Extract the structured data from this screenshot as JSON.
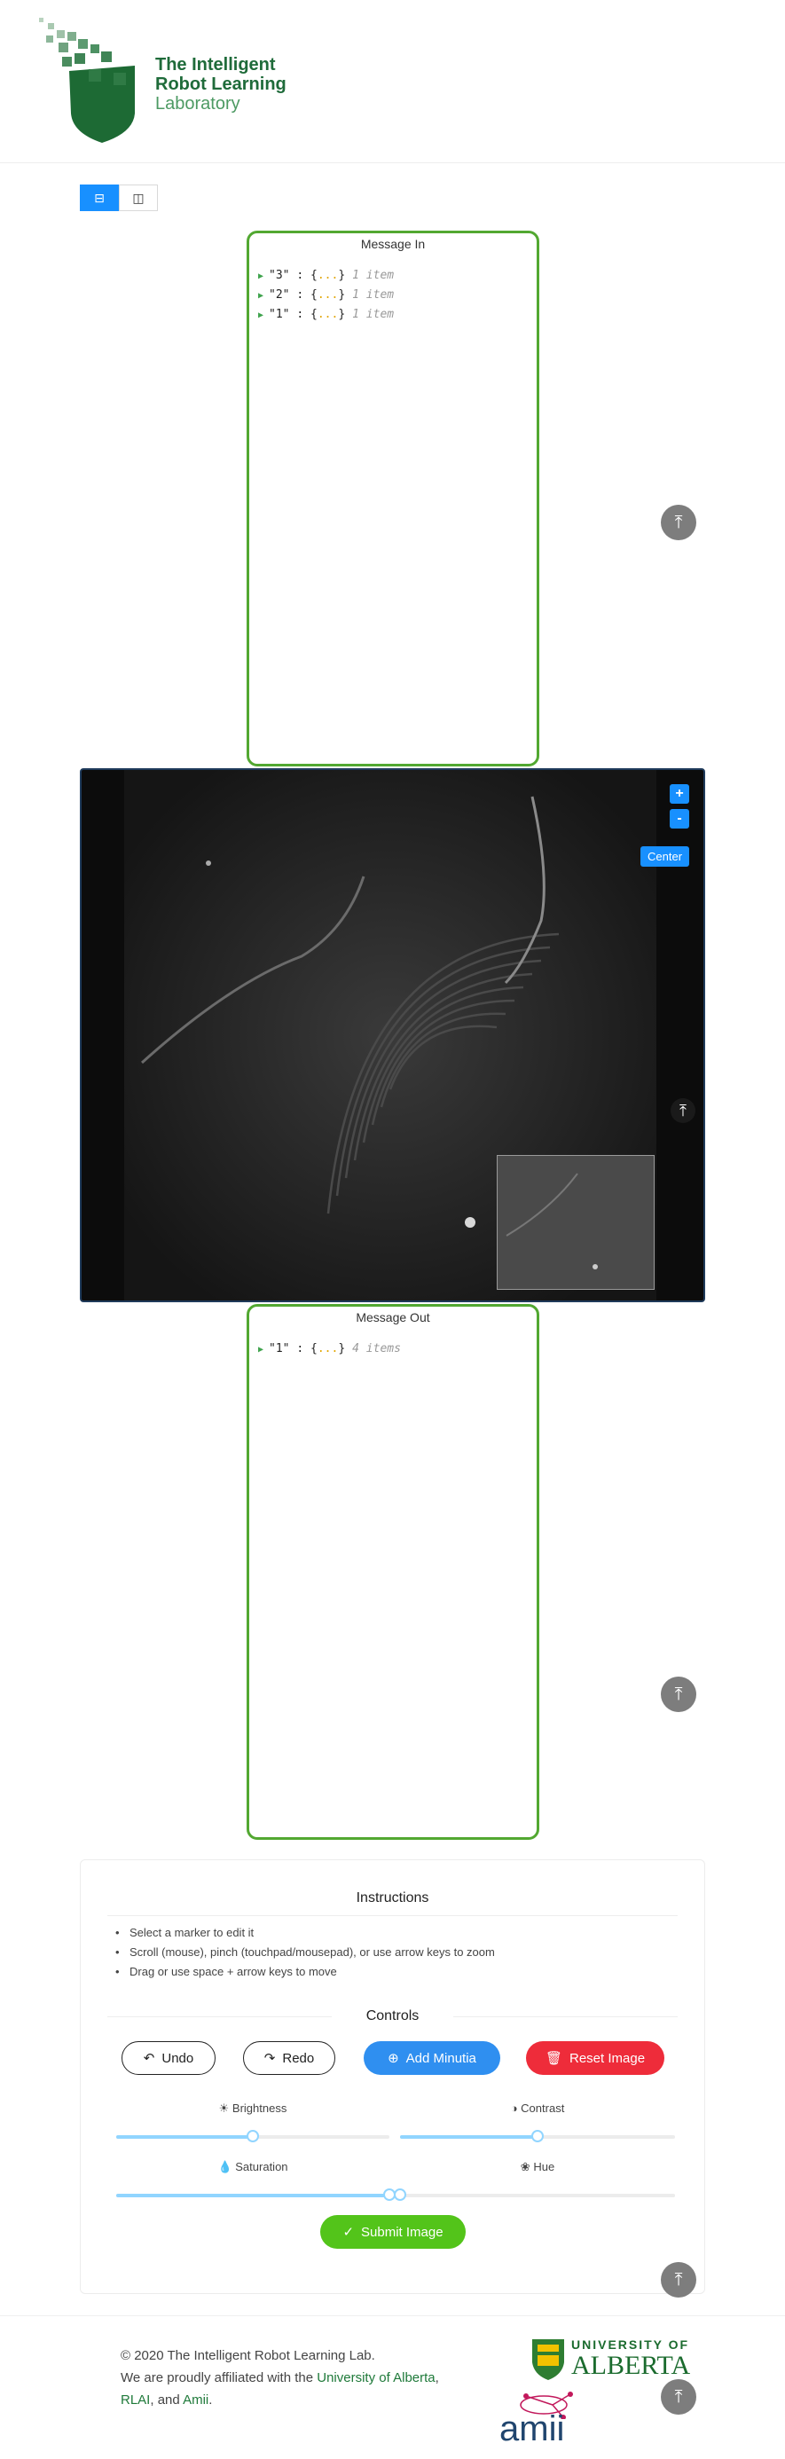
{
  "header": {
    "logo_line1": "The Intelligent",
    "logo_line2": "Robot Learning",
    "logo_line3": "Laboratory"
  },
  "view_toggle": {
    "single_icon": "single-view-icon",
    "split_icon": "split-view-icon"
  },
  "message_in": {
    "title": "Message In",
    "items": [
      {
        "key": "\"3\"",
        "count": "1 item"
      },
      {
        "key": "\"2\"",
        "count": "1 item"
      },
      {
        "key": "\"1\"",
        "count": "1 item"
      }
    ]
  },
  "viewer": {
    "zoom_in": "+",
    "zoom_out": "-",
    "center_label": "Center"
  },
  "message_out": {
    "title": "Message Out",
    "items": [
      {
        "key": "\"1\"",
        "count": "4 items"
      }
    ]
  },
  "instructions": {
    "title": "Instructions",
    "items": [
      "Select a marker to edit it",
      "Scroll (mouse), pinch (touchpad/mousepad), or use arrow keys to zoom",
      "Drag or use space + arrow keys to move"
    ]
  },
  "controls": {
    "title": "Controls",
    "undo": "Undo",
    "redo": "Redo",
    "add_minutia": "Add Minutia",
    "reset_image": "Reset Image",
    "brightness": "Brightness",
    "contrast": "Contrast",
    "saturation": "Saturation",
    "hue": "Hue",
    "submit": "Submit Image",
    "brightness_value": 0.5,
    "contrast_value": 0.5,
    "saturation_value": 1.0,
    "hue_value": 0.0
  },
  "footer": {
    "copyright": "© 2020 The Intelligent Robot Learning Lab.",
    "affiliated_prefix": "We are proudly affiliated with the",
    "link_ualberta": "University of Alberta",
    "comma": ",",
    "link_rlai": "RLAI",
    "and_text": ", and",
    "link_amii": "Amii",
    "period": ".",
    "ualberta_logo_line1": "UNIVERSITY OF",
    "ualberta_logo_line2": "ALBERTA",
    "amii_logo": "amii"
  },
  "colors": {
    "accent_blue": "#1890ff",
    "panel_green": "#52a831",
    "danger_red": "#ee2c3a",
    "success_green": "#53c41a",
    "lab_green": "#1f6b3a"
  }
}
